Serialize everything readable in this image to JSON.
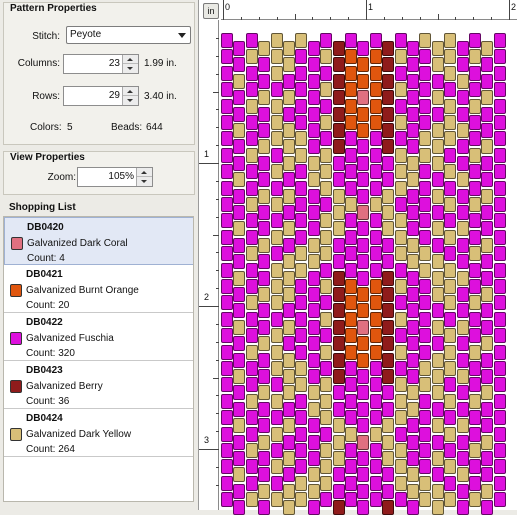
{
  "pattern_properties": {
    "title": "Pattern Properties",
    "stitch_label": "Stitch:",
    "stitch_value": "Peyote",
    "columns_label": "Columns:",
    "columns_value": "23",
    "columns_inches": "1.99 in.",
    "rows_label": "Rows:",
    "rows_value": "29",
    "rows_inches": "3.40 in.",
    "colors_label": "Colors:",
    "colors_value": "5",
    "beads_label": "Beads:",
    "beads_value": "644"
  },
  "view_properties": {
    "title": "View Properties",
    "zoom_label": "Zoom:",
    "zoom_value": "105%"
  },
  "shopping_list": {
    "title": "Shopping List",
    "items": [
      {
        "code": "DB0420",
        "name": "Galvanized Dark Coral",
        "count": "Count: 4",
        "color": "#e07080",
        "selected": true
      },
      {
        "code": "DB0421",
        "name": "Galvanized Burnt Orange",
        "count": "Count: 20",
        "color": "#e0560e",
        "selected": false
      },
      {
        "code": "DB0422",
        "name": "Galvanized Fuschia",
        "count": "Count: 320",
        "color": "#dd10dd",
        "selected": false
      },
      {
        "code": "DB0423",
        "name": "Galvanized Berry",
        "count": "Count: 36",
        "color": "#8f1b1b",
        "selected": false
      },
      {
        "code": "DB0424",
        "name": "Galvanized Dark Yellow",
        "count": "Count: 264",
        "color": "#d8bf78",
        "selected": false
      }
    ]
  },
  "canvas": {
    "unit_button": "in",
    "ruler_top_labels": [
      "0",
      "1",
      "2"
    ],
    "ruler_left_labels": [
      "1",
      "2",
      "3"
    ]
  }
}
